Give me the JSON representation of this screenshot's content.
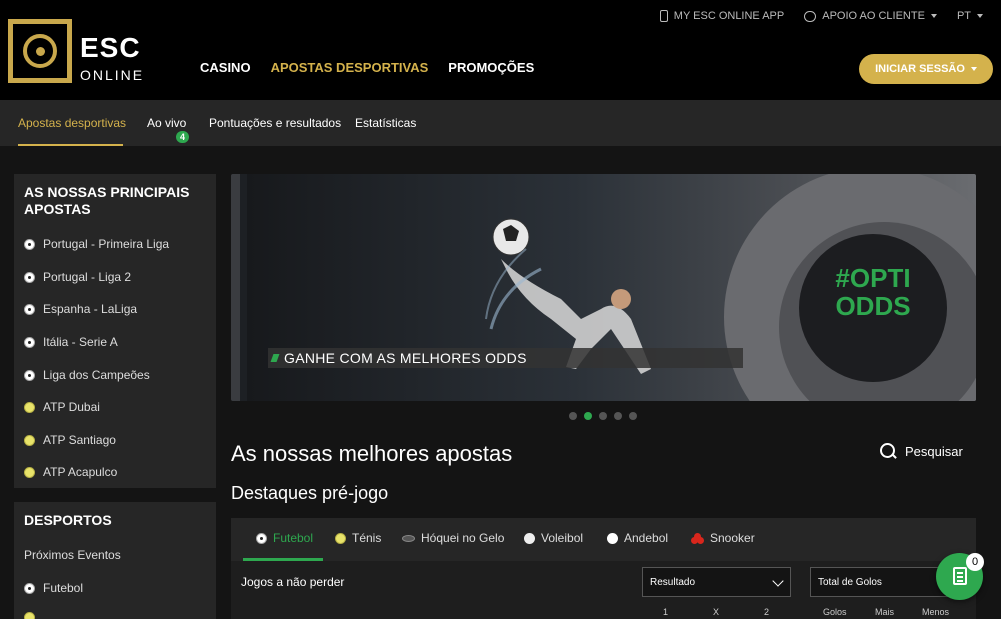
{
  "brand": {
    "name": "ESC",
    "sub": "ONLINE",
    "gold": "#d4b24c",
    "green": "#2ea84f"
  },
  "top_links": {
    "app": "MY ESC ONLINE APP",
    "support": "APOIO AO CLIENTE",
    "lang": "PT"
  },
  "main_nav": {
    "casino": "CASINO",
    "sports": "APOSTAS DESPORTIVAS",
    "promos": "PROMOÇÕES"
  },
  "login": {
    "label": "INICIAR SESSÃO"
  },
  "sub_nav": {
    "items": [
      "Apostas desportivas",
      "Ao vivo",
      "Pontuações e resultados",
      "Estatísticas"
    ],
    "live_count": "4"
  },
  "sidebar": {
    "top_bets": {
      "title": "AS NOSSAS PRINCIPAIS APOSTAS",
      "items": [
        {
          "label": "Portugal - Primeira Liga",
          "icon": "soccer-ball-icon"
        },
        {
          "label": "Portugal - Liga 2",
          "icon": "soccer-ball-icon"
        },
        {
          "label": "Espanha - LaLiga",
          "icon": "soccer-ball-icon"
        },
        {
          "label": "Itália - Serie A",
          "icon": "soccer-ball-icon"
        },
        {
          "label": "Liga dos Campeões",
          "icon": "soccer-ball-icon"
        },
        {
          "label": "ATP Dubai",
          "icon": "tennis-ball-icon"
        },
        {
          "label": "ATP Santiago",
          "icon": "tennis-ball-icon"
        },
        {
          "label": "ATP Acapulco",
          "icon": "tennis-ball-icon"
        }
      ]
    },
    "sports": {
      "title": "DESPORTOS",
      "items": [
        "Próximos Eventos",
        "Futebol"
      ]
    }
  },
  "banner": {
    "caption": "GANHE COM AS MELHORES ODDS",
    "badge_line1": "#OPTI",
    "badge_line2": "ODDS",
    "slides": 5,
    "active_slide": 2
  },
  "section": {
    "title": "As nossas melhores apostas",
    "subtitle": "Destaques pré-jogo",
    "search": "Pesquisar"
  },
  "sport_tabs": [
    "Futebol",
    "Ténis",
    "Hóquei no Gelo",
    "Voleibol",
    "Andebol",
    "Snooker"
  ],
  "filters": {
    "label": "Jogos a não perder",
    "select1": "Resultado",
    "select2": "Total de Golos"
  },
  "columns": [
    "1",
    "X",
    "2",
    "Golos",
    "Mais",
    "Menos"
  ],
  "betslip": {
    "count": "0"
  }
}
